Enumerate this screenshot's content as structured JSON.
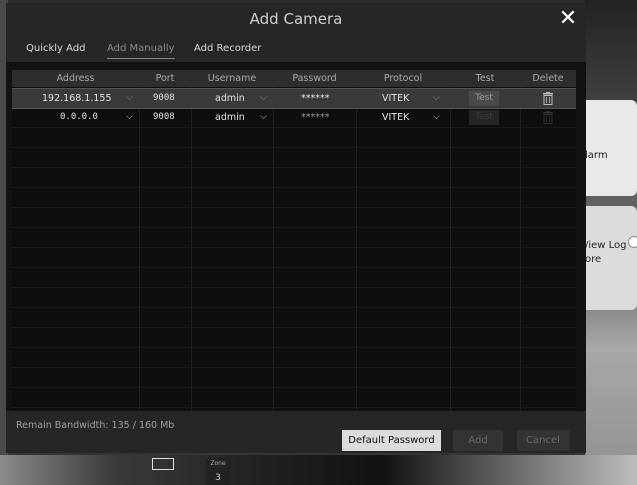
{
  "background": {
    "side_card_1_text": "larm",
    "side_card_2_text_1": "/iew Log",
    "side_card_2_text_2": "ore",
    "bottom_tab_small": "Zone",
    "bottom_tab_number": "3"
  },
  "dialog": {
    "title": "Add Camera",
    "close_label": "✕",
    "tabs": [
      {
        "label": "Quickly Add"
      },
      {
        "label": "Add Manually"
      },
      {
        "label": "Add Recorder"
      }
    ],
    "columns": [
      "Address",
      "Port",
      "Username",
      "Password",
      "Protocol",
      "Test",
      "Delete"
    ],
    "rows": [
      {
        "address": "192.168.1.155",
        "port": "9008",
        "username": "admin",
        "password": "******",
        "protocol": "VITEK",
        "test": "Test"
      },
      {
        "address": "0.0.0.0",
        "port": "9008",
        "username": "admin",
        "password": "******",
        "protocol": "VITEK",
        "test": "Test"
      }
    ],
    "bandwidth": "Remain Bandwidth: 135 / 160 Mb",
    "buttons": {
      "default_password": "Default Password",
      "add": "Add",
      "cancel": "Cancel"
    }
  },
  "colors": {
    "dialog_bg": "#121212",
    "header_bg": "#262626",
    "selected_row": "#3a3a3a"
  }
}
